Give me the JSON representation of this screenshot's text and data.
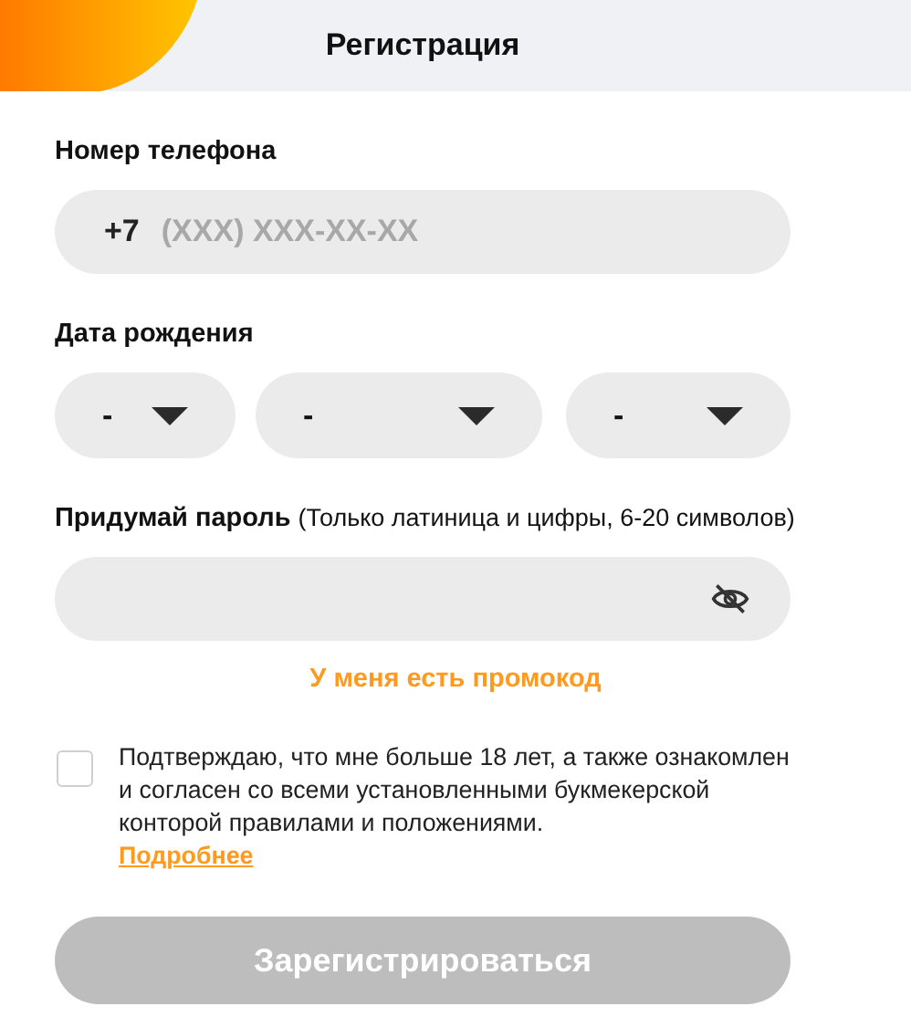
{
  "header": {
    "title": "Регистрация"
  },
  "phone": {
    "label": "Номер телефона",
    "prefix": "+7",
    "placeholder": "(XXX) XXX-XX-XX"
  },
  "birth_date": {
    "label": "Дата рождения",
    "selects": [
      {
        "value": "-"
      },
      {
        "value": "-"
      },
      {
        "value": "-"
      }
    ]
  },
  "password": {
    "label": "Придумай пароль",
    "hint": "(Только латиница и цифры, 6-20 символов)"
  },
  "promo_link": "У меня есть промокод",
  "agreement": {
    "checked": false,
    "text": "Подтверждаю, что мне больше 18 лет, а также ознакомлен и согласен со всеми установленными букмекерской конторой правилами и положениями.",
    "link": "Подробнее"
  },
  "submit": {
    "label": "Зарегистрироваться",
    "disabled": true
  }
}
